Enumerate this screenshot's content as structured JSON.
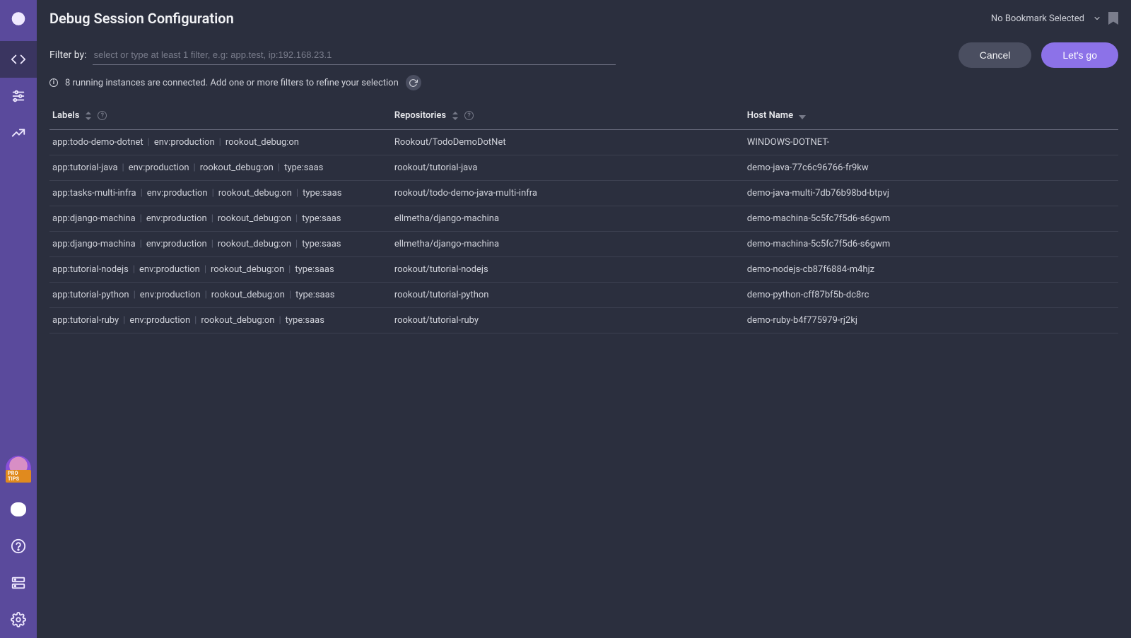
{
  "page": {
    "title": "Debug Session Configuration"
  },
  "topbar": {
    "bookmark_label": "No Bookmark Selected"
  },
  "filter": {
    "label": "Filter by:",
    "placeholder": "select or type at least 1 filter, e.g: app.test, ip:192.168.23.1"
  },
  "status": {
    "message": "8 running instances are connected. Add one or more filters to refine your selection"
  },
  "actions": {
    "cancel": "Cancel",
    "go": "Let's go"
  },
  "sidebar": {
    "protips_label": "PRO TIPS"
  },
  "table": {
    "columns": {
      "labels": "Labels",
      "repositories": "Repositories",
      "hostname": "Host Name"
    },
    "rows": [
      {
        "labels": [
          "app:todo-demo-dotnet",
          "env:production",
          "rookout_debug:on"
        ],
        "repository": "Rookout/TodoDemoDotNet",
        "hostname": "WINDOWS-DOTNET-"
      },
      {
        "labels": [
          "app:tutorial-java",
          "env:production",
          "rookout_debug:on",
          "type:saas"
        ],
        "repository": "rookout/tutorial-java",
        "hostname": "demo-java-77c6c96766-fr9kw"
      },
      {
        "labels": [
          "app:tasks-multi-infra",
          "env:production",
          "rookout_debug:on",
          "type:saas"
        ],
        "repository": "rookout/todo-demo-java-multi-infra",
        "hostname": "demo-java-multi-7db76b98bd-btpvj"
      },
      {
        "labels": [
          "app:django-machina",
          "env:production",
          "rookout_debug:on",
          "type:saas"
        ],
        "repository": "ellmetha/django-machina",
        "hostname": "demo-machina-5c5fc7f5d6-s6gwm"
      },
      {
        "labels": [
          "app:django-machina",
          "env:production",
          "rookout_debug:on",
          "type:saas"
        ],
        "repository": "ellmetha/django-machina",
        "hostname": "demo-machina-5c5fc7f5d6-s6gwm"
      },
      {
        "labels": [
          "app:tutorial-nodejs",
          "env:production",
          "rookout_debug:on",
          "type:saas"
        ],
        "repository": "rookout/tutorial-nodejs",
        "hostname": "demo-nodejs-cb87f6884-m4hjz"
      },
      {
        "labels": [
          "app:tutorial-python",
          "env:production",
          "rookout_debug:on",
          "type:saas"
        ],
        "repository": "rookout/tutorial-python",
        "hostname": "demo-python-cff87bf5b-dc8rc"
      },
      {
        "labels": [
          "app:tutorial-ruby",
          "env:production",
          "rookout_debug:on",
          "type:saas"
        ],
        "repository": "rookout/tutorial-ruby",
        "hostname": "demo-ruby-b4f775979-rj2kj"
      }
    ]
  }
}
